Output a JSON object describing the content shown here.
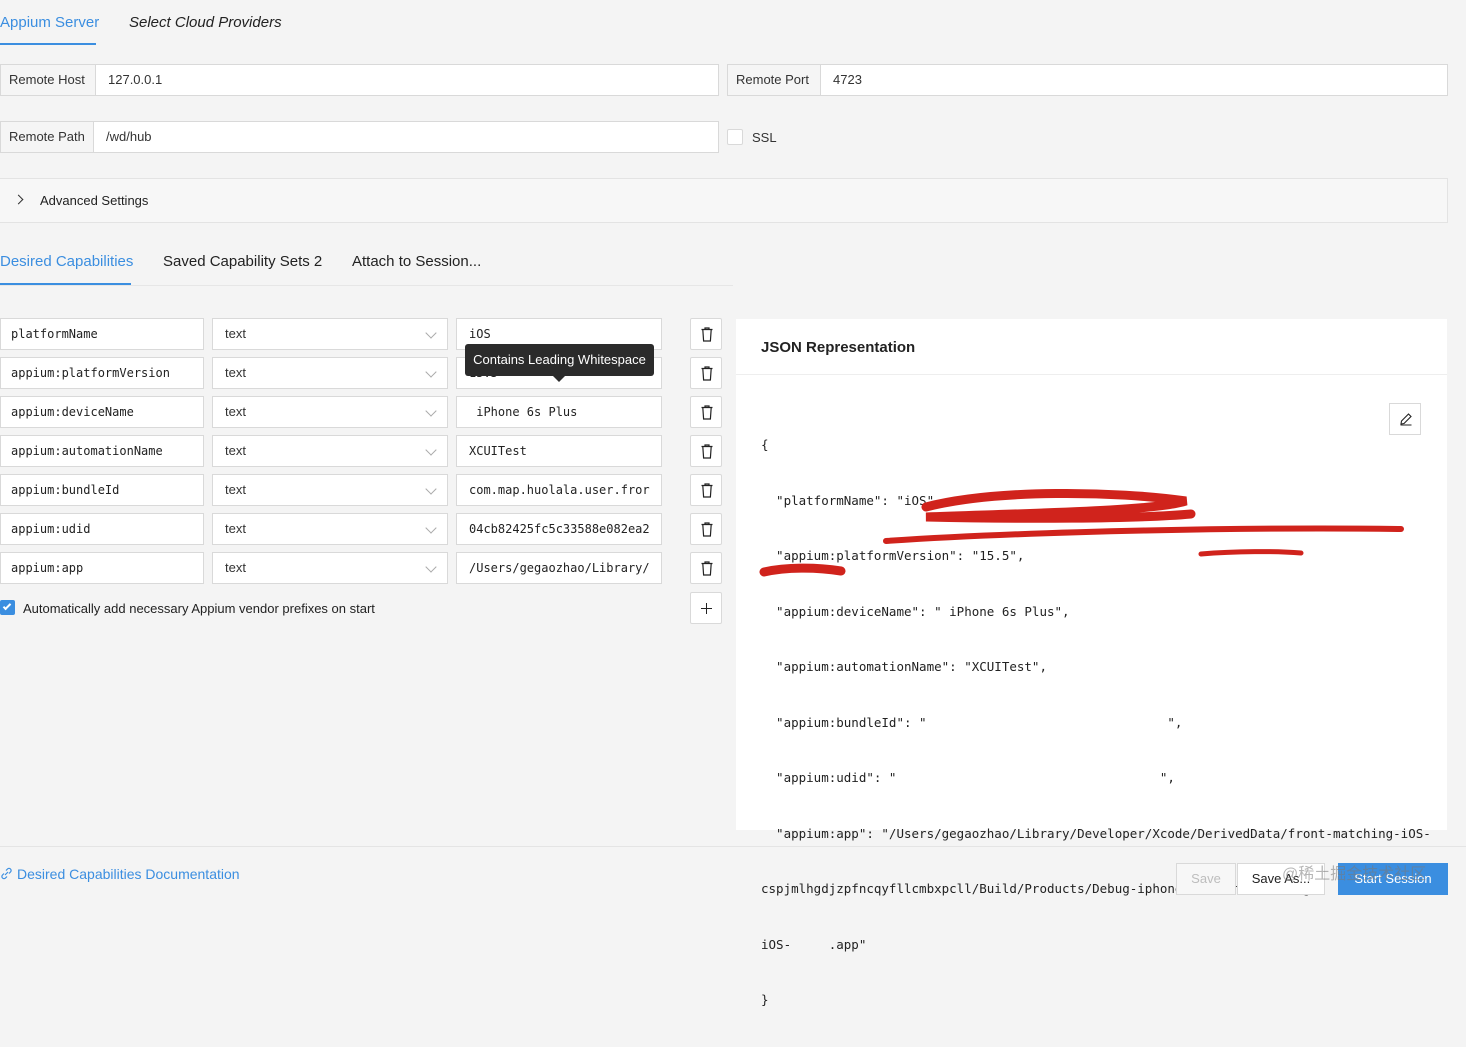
{
  "top_tabs": [
    {
      "label": "Appium Server",
      "active": true
    },
    {
      "label": "Select Cloud Providers",
      "active": false
    }
  ],
  "server": {
    "remote_host_label": "Remote Host",
    "remote_host_value": "127.0.0.1",
    "remote_port_label": "Remote Port",
    "remote_port_value": "4723",
    "remote_path_label": "Remote Path",
    "remote_path_value": "/wd/hub",
    "ssl_label": "SSL",
    "ssl_checked": false
  },
  "advanced_settings_label": "Advanced Settings",
  "cap_tabs": [
    {
      "label": "Desired Capabilities",
      "active": true
    },
    {
      "label": "Saved Capability Sets 2",
      "active": false
    },
    {
      "label": "Attach to Session...",
      "active": false
    }
  ],
  "capabilities": [
    {
      "name": "platformName",
      "type": "text",
      "value": "iOS"
    },
    {
      "name": "appium:platformVersion",
      "type": "text",
      "value": "15.5"
    },
    {
      "name": "appium:deviceName",
      "type": "text",
      "value": " iPhone 6s Plus"
    },
    {
      "name": "appium:automationName",
      "type": "text",
      "value": "XCUITest"
    },
    {
      "name": "appium:bundleId",
      "type": "text",
      "value": "com.map.huolala.user.fror"
    },
    {
      "name": "appium:udid",
      "type": "text",
      "value": "04cb82425fc5c33588e082ea2"
    },
    {
      "name": "appium:app",
      "type": "text",
      "value": "/Users/gegaozhao/Library/"
    }
  ],
  "tooltip": "Contains Leading Whitespace",
  "auto_prefix_label": "Automatically add necessary Appium vendor prefixes on start",
  "auto_prefix_checked": true,
  "json": {
    "title": "JSON Representation",
    "lines": [
      "{",
      "  \"platformName\": \"iOS\",",
      "  \"appium:platformVersion\": \"15.5\",",
      "  \"appium:deviceName\": \" iPhone 6s Plus\",",
      "  \"appium:automationName\": \"XCUITest\",",
      "  \"appium:bundleId\": \"                                \",",
      "  \"appium:udid\": \"                                   \",",
      "  \"appium:app\": \"/Users/gegaozhao/Library/Developer/Xcode/DerivedData/front-matching-iOS-",
      "cspjmlhgdjzpfncqyfllcmbxpcll/Build/Products/Debug-iphoneos/front-matching-",
      "iOS-     .app\"",
      "}"
    ]
  },
  "footer": {
    "docs_link": "Desired Capabilities Documentation",
    "save": "Save",
    "save_as": "Save As...",
    "start_session": "Start Session",
    "watermark": "@稀土掘金技术社区"
  },
  "colors": {
    "accent": "#3b8ee0",
    "redaction": "#d0231c"
  }
}
